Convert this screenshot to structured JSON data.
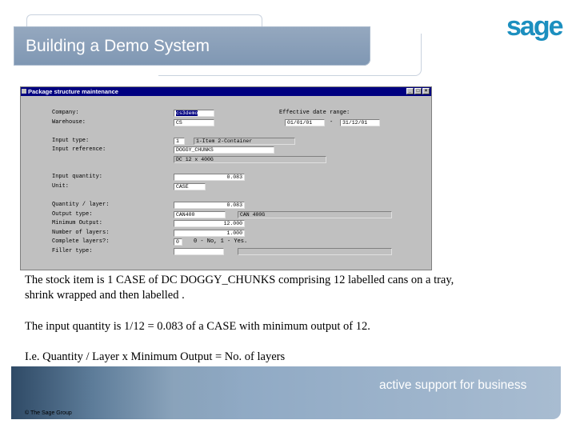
{
  "slide": {
    "title": "Building a Demo System",
    "logo": "sage",
    "slogan": "active support for business",
    "copyright": "© The Sage Group"
  },
  "window": {
    "title": "Package structure maintenance",
    "buttons": [
      "_",
      "□",
      "×"
    ]
  },
  "form": {
    "company_label": "Company:",
    "company_value": "cs3demo",
    "warehouse_label": "Warehouse:",
    "warehouse_value": "CS",
    "date_range_label": "Effective date range:",
    "date_from": "01/01/01",
    "date_sep": "-",
    "date_to": "31/12/01",
    "input_type_label": "Input type:",
    "input_type_value": "1",
    "input_type_desc": "1-Item 2-Container",
    "input_ref_label": "Input reference:",
    "input_ref_value": "DOGGY_CHUNKS",
    "input_ref_desc": "DC 12 x 400G",
    "input_qty_label": "Input quantity:",
    "input_qty_value": "0.083",
    "unit_label": "Unit:",
    "unit_value": "CASE",
    "qty_layer_label": "Quantity / layer:",
    "qty_layer_value": "0.083",
    "output_type_label": "Output type:",
    "output_type_value": "CAN400",
    "output_type_desc": "CAN 400G",
    "min_output_label": "Minimum Output:",
    "min_output_value": "12.000",
    "num_layers_label": "Number of layers:",
    "num_layers_value": "1.000",
    "complete_layers_label": "Complete layers?:",
    "complete_layers_value": "0",
    "complete_layers_desc": "0 - No, 1 - Yes.",
    "filler_type_label": "Filler type:",
    "filler_type_value": ""
  },
  "text": {
    "line1": "The stock item is 1 CASE of  DC DOGGY_CHUNKS comprising 12 labelled cans on a tray,",
    "line2": "shrink wrapped and then labelled .",
    "line3": "The input quantity is 1/12 = 0.083 of a CASE with minimum output of 12.",
    "line4": "I.e. Quantity / Layer  x  Minimum Output = No. of layers"
  }
}
